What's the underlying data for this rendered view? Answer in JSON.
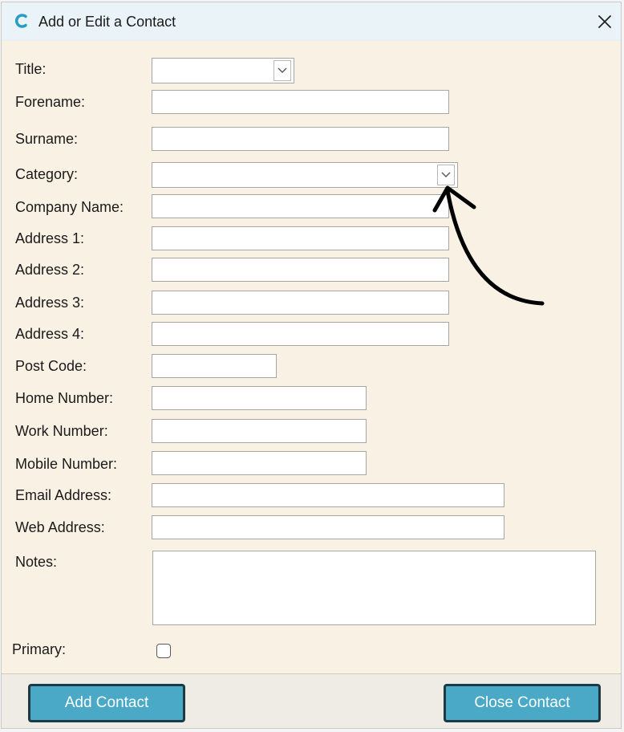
{
  "window": {
    "title": "Add or Edit a Contact",
    "icon": "c-logo-icon",
    "close_icon": "close-icon"
  },
  "form": {
    "title_label": "Title:",
    "title_value": "",
    "forename_label": "Forename:",
    "forename_value": "",
    "surname_label": "Surname:",
    "surname_value": "",
    "category_label": "Category:",
    "category_value": "",
    "company_label": "Company Name:",
    "company_value": "",
    "address1_label": "Address 1:",
    "address1_value": "",
    "address2_label": "Address 2:",
    "address2_value": "",
    "address3_label": "Address 3:",
    "address3_value": "",
    "address4_label": "Address 4:",
    "address4_value": "",
    "postcode_label": "Post Code:",
    "postcode_value": "",
    "home_label": "Home Number:",
    "home_value": "",
    "work_label": "Work Number:",
    "work_value": "",
    "mobile_label": "Mobile Number:",
    "mobile_value": "",
    "email_label": "Email Address:",
    "email_value": "",
    "web_label": "Web Address:",
    "web_value": "",
    "notes_label": "Notes:",
    "notes_value": "",
    "primary_label": "Primary:",
    "primary_checked": false
  },
  "footer": {
    "add_label": "Add Contact",
    "close_label": "Close Contact"
  },
  "colors": {
    "form_background": "#faf1e5",
    "titlebar_background": "#eaf4f8",
    "button_fill": "#4aa9c7",
    "button_border": "#1d3a44",
    "app_icon": "#2a9cbf"
  },
  "annotation": {
    "type": "curved-arrow",
    "points_to": "category-dropdown-button"
  }
}
